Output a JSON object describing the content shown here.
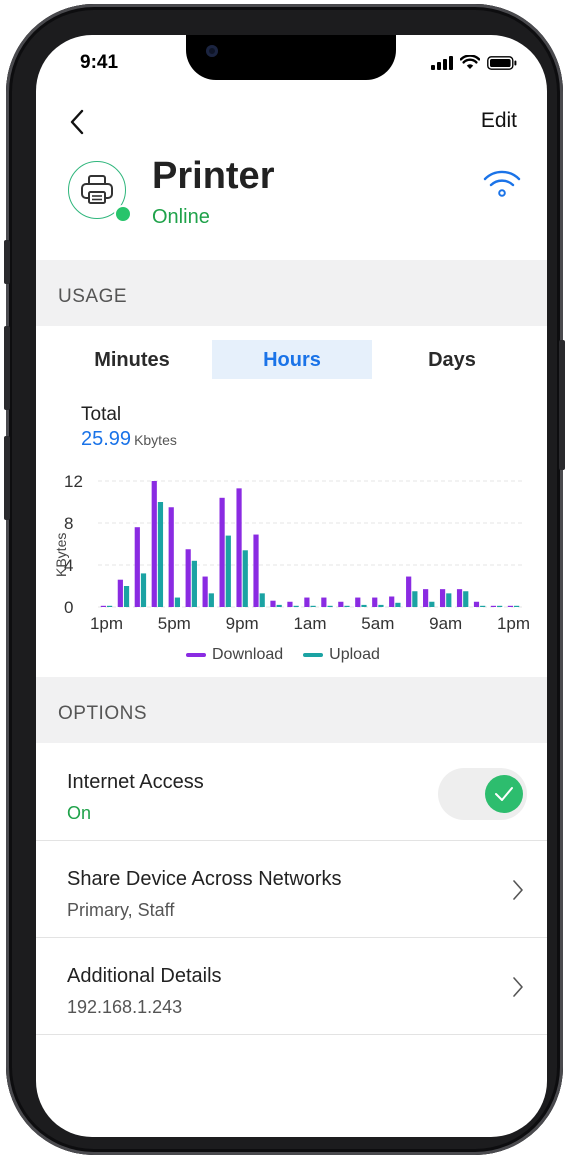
{
  "status_bar": {
    "time": "9:41"
  },
  "nav": {
    "edit_label": "Edit"
  },
  "device": {
    "name": "Printer",
    "status": "Online"
  },
  "usage": {
    "section_title": "USAGE",
    "tabs": [
      {
        "label": "Minutes",
        "active": false
      },
      {
        "label": "Hours",
        "active": true
      },
      {
        "label": "Days",
        "active": false
      }
    ],
    "total_label": "Total",
    "total_value": "25.99",
    "total_unit": "Kbytes"
  },
  "chart_data": {
    "type": "bar",
    "ylabel": "KBytes",
    "ylim": [
      0,
      12
    ],
    "y_ticks": [
      "12",
      "8",
      "4",
      "0"
    ],
    "x_tick_labels": [
      "1pm",
      "5pm",
      "9pm",
      "1am",
      "5am",
      "9am",
      "1pm"
    ],
    "categories": [
      "1pm",
      "2pm",
      "3pm",
      "4pm",
      "5pm",
      "6pm",
      "7pm",
      "8pm",
      "9pm",
      "10pm",
      "11pm",
      "12am",
      "1am",
      "2am",
      "3am",
      "4am",
      "5am",
      "6am",
      "7am",
      "8am",
      "9am",
      "10am",
      "11am",
      "12pm",
      "1pm"
    ],
    "series": [
      {
        "name": "Download",
        "color": "#8a2be2",
        "values": [
          0.1,
          2.6,
          7.6,
          12.0,
          9.5,
          5.5,
          2.9,
          10.4,
          11.3,
          6.9,
          0.6,
          0.5,
          0.9,
          0.9,
          0.5,
          0.9,
          0.9,
          1.0,
          2.9,
          1.7,
          1.7,
          1.7,
          0.5,
          0.1,
          0.0
        ]
      },
      {
        "name": "Upload",
        "color": "#1ba3a3",
        "values": [
          0.1,
          2.0,
          3.2,
          10.0,
          0.9,
          4.4,
          1.3,
          6.8,
          5.4,
          1.3,
          0.2,
          0.1,
          0.1,
          0.1,
          0.1,
          0.2,
          0.2,
          0.4,
          1.5,
          0.5,
          1.3,
          1.5,
          0.1,
          0.1,
          0.0
        ]
      }
    ],
    "legend": [
      "Download",
      "Upload"
    ],
    "legend_position": "bottom",
    "grid": true
  },
  "options": {
    "section_title": "OPTIONS",
    "internet_access": {
      "title": "Internet Access",
      "value": "On",
      "enabled": true
    },
    "share_device": {
      "title": "Share Device Across Networks",
      "value": "Primary, Staff"
    },
    "additional_details": {
      "title": "Additional Details",
      "value": "192.168.1.243"
    }
  },
  "colors": {
    "accent_blue": "#1a73e8",
    "online_green": "#1fa24a",
    "toggle_green": "#2dbd6e",
    "download": "#8a2be2",
    "upload": "#1ba3a3"
  }
}
